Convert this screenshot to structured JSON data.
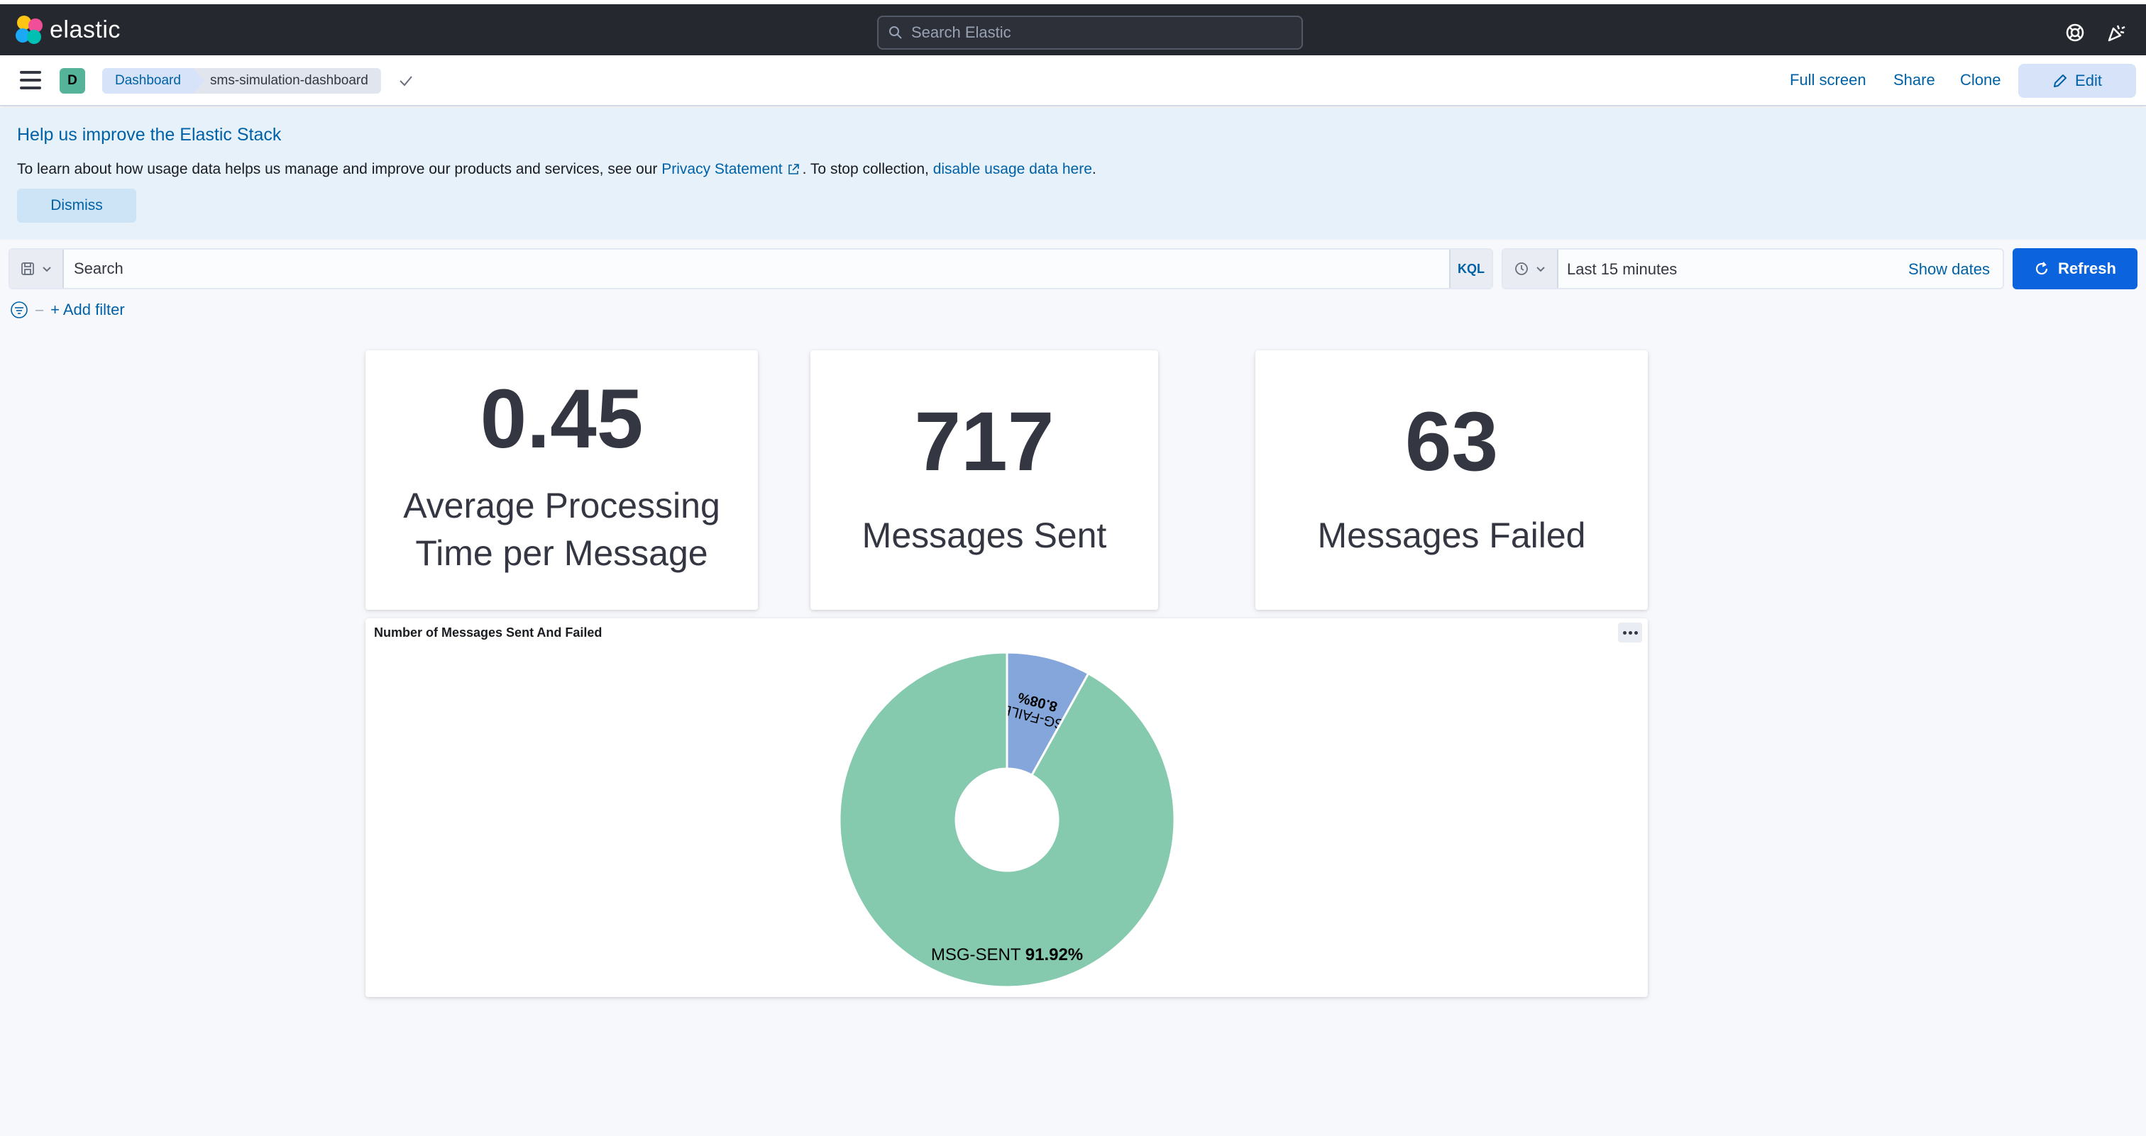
{
  "header": {
    "logo_text": "elastic",
    "search_placeholder": "Search Elastic"
  },
  "navbar": {
    "space_initial": "D",
    "breadcrumbs": [
      "Dashboard",
      "sms-simulation-dashboard"
    ],
    "actions": {
      "full_screen": "Full screen",
      "share": "Share",
      "clone": "Clone",
      "edit": "Edit"
    }
  },
  "callout": {
    "title": "Help us improve the Elastic Stack",
    "text_before": "To learn about how usage data helps us manage and improve our products and services, see our ",
    "privacy_link": "Privacy Statement",
    "text_middle": ". To stop collection, ",
    "disable_link": "disable usage data here",
    "text_end": ".",
    "dismiss": "Dismiss"
  },
  "query": {
    "placeholder": "Search",
    "language": "KQL",
    "time_range": "Last 15 minutes",
    "show_dates": "Show dates",
    "refresh": "Refresh",
    "add_filter": "+ Add filter"
  },
  "metrics": [
    {
      "value": "0.45",
      "label_line1": "Average Processing",
      "label_line2": "Time per Message"
    },
    {
      "value": "717",
      "label": "Messages Sent"
    },
    {
      "value": "63",
      "label": "Messages Failed"
    }
  ],
  "colors": {
    "sent": "#85caaf",
    "failed": "#84a6da",
    "accent": "#0b64dd"
  },
  "chart_data": {
    "type": "pie",
    "donut": true,
    "title": "Number of Messages Sent And Failed",
    "slices": [
      {
        "label": "MSG-FAILED",
        "percent": 8.08,
        "percent_label": "8.08%",
        "color": "#84a6da"
      },
      {
        "label": "MSG-SENT",
        "percent": 91.92,
        "percent_label": "91.92%",
        "color": "#85caaf"
      }
    ]
  }
}
